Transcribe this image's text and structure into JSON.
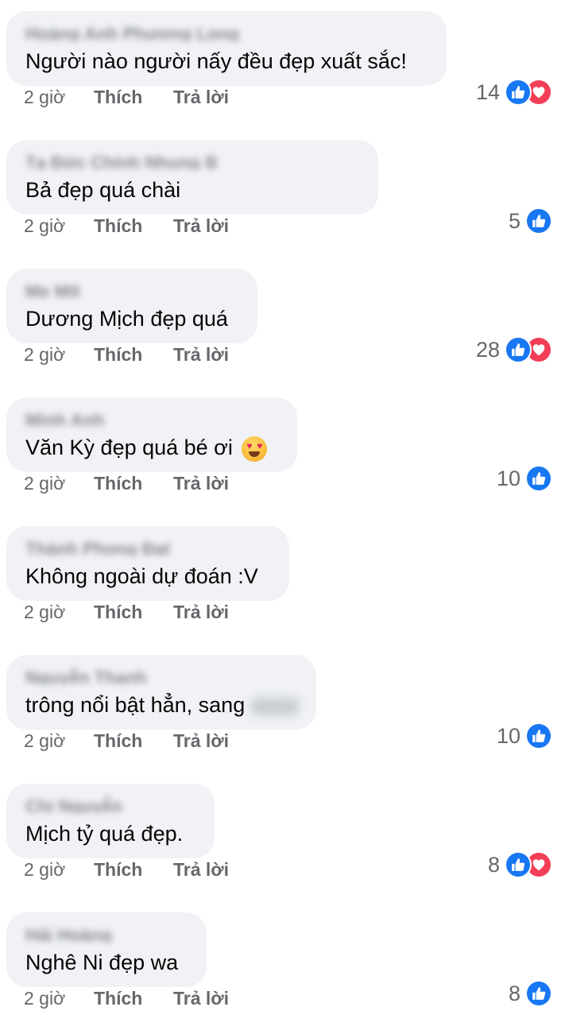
{
  "meta": {
    "time": "2 giờ",
    "like_label": "Thích",
    "reply_label": "Trả lời"
  },
  "comments": [
    {
      "author": "Hoàng Anh Phương Long",
      "text": "Người nào người nấy đều đẹp xuất sắc!",
      "count": "14",
      "reactions": [
        "like",
        "love"
      ]
    },
    {
      "author": "Tạ Đức Chính Nhung B",
      "text": "Bả đẹp quá chài",
      "count": "5",
      "reactions": [
        "like"
      ]
    },
    {
      "author": "Mẹ Mít",
      "text": "Dương Mịch đẹp quá",
      "count": "28",
      "reactions": [
        "like",
        "love"
      ]
    },
    {
      "author": "Minh Anh",
      "text": "Văn Kỳ đẹp quá bé ơi",
      "count": "10",
      "reactions": [
        "like"
      ]
    },
    {
      "author": "Thành Phong Đạt",
      "text": "Không ngoài dự đoán :V",
      "count": "",
      "reactions": []
    },
    {
      "author": "Nguyễn Thanh",
      "text": "trông nổi bật hẳn, sang",
      "count": "10",
      "reactions": [
        "like"
      ]
    },
    {
      "author": "Chi Nguyễn",
      "text": "Mịch tỷ quá đẹp.",
      "count": "8",
      "reactions": [
        "like",
        "love"
      ]
    },
    {
      "author": "Hải Hoàng",
      "text": "Nghê Ni đẹp wa",
      "count": "8",
      "reactions": [
        "like"
      ]
    }
  ],
  "colors": {
    "like": "#1877f2",
    "love": "#f33e58",
    "bubble": "#f0f2f5",
    "meta_text": "#65676b"
  },
  "icons": {
    "like": "thumbs-up-icon",
    "love": "heart-icon",
    "emoji": "heart-eyes-emoji-icon"
  }
}
